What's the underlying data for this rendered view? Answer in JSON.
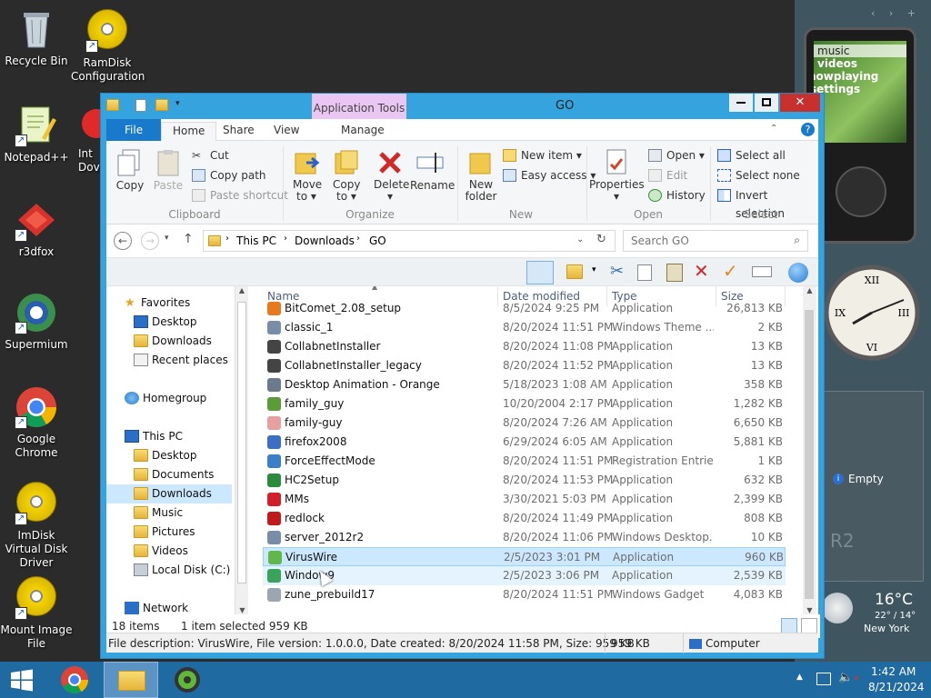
{
  "desktop": {
    "icons": [
      {
        "label": "Recycle Bin"
      },
      {
        "label": "RamDisk Configuration"
      },
      {
        "label": "Notepad++"
      },
      {
        "label": "Int Dov"
      },
      {
        "label": "r3dfox"
      },
      {
        "label": "Supermium"
      },
      {
        "label": "Google Chrome"
      },
      {
        "label": "ImDisk Virtual Disk Driver"
      },
      {
        "label": "Mount Image File"
      }
    ]
  },
  "gadgets": {
    "zune_menu": [
      "music",
      "videos",
      "nowplaying",
      "settings"
    ],
    "recycle": {
      "label": "Empty"
    },
    "weather": {
      "temp": "16°C",
      "range": "22° / 14°",
      "city": "New York"
    },
    "r2": "R2"
  },
  "window": {
    "title": "GO",
    "app_tools_label": "Application Tools",
    "tabs": [
      "File",
      "Home",
      "Share",
      "View",
      "Manage"
    ],
    "ribbon": {
      "clipboard": {
        "copy": "Copy",
        "paste": "Paste",
        "cut": "Cut",
        "copy_path": "Copy path",
        "paste_shortcut": "Paste shortcut",
        "label": "Clipboard"
      },
      "organize": {
        "move_to": "Move to ▾",
        "copy_to": "Copy to ▾",
        "delete": "Delete ▾",
        "rename": "Rename",
        "label": "Organize"
      },
      "new": {
        "new_folder": "New folder",
        "new_item": "New item ▾",
        "easy_access": "Easy access ▾",
        "label": "New"
      },
      "open": {
        "properties": "Properties ▾",
        "open": "Open ▾",
        "edit": "Edit",
        "history": "History",
        "label": "Open"
      },
      "select": {
        "select_all": "Select all",
        "select_none": "Select none",
        "invert": "Invert selection",
        "label": "Select"
      }
    },
    "address": {
      "crumbs": [
        "This PC",
        "Downloads",
        "GO"
      ],
      "search_placeholder": "Search GO"
    },
    "nav": {
      "favorites": "Favorites",
      "fav_items": [
        "Desktop",
        "Downloads",
        "Recent places"
      ],
      "homegroup": "Homegroup",
      "thispc": "This PC",
      "pc_items": [
        "Desktop",
        "Documents",
        "Downloads",
        "Music",
        "Pictures",
        "Videos",
        "Local Disk (C:)"
      ],
      "network": "Network"
    },
    "columns": [
      "Name",
      "Date modified",
      "Type",
      "Size"
    ],
    "files": [
      {
        "name": "BitComet_2.08_setup",
        "date": "8/5/2024 9:25 PM",
        "type": "Application",
        "size": "26,813 KB",
        "color": "#e87a1e"
      },
      {
        "name": "classic_1",
        "date": "8/20/2024 11:51 PM",
        "type": "Windows Theme ...",
        "size": "2 KB",
        "color": "#7a8da8"
      },
      {
        "name": "CollabnetInstaller",
        "date": "8/20/2024 11:08 PM",
        "type": "Application",
        "size": "13 KB",
        "color": "#444444"
      },
      {
        "name": "CollabnetInstaller_legacy",
        "date": "8/20/2024 11:52 PM",
        "type": "Application",
        "size": "13 KB",
        "color": "#444444"
      },
      {
        "name": "Desktop Animation - Orange",
        "date": "5/18/2023 1:08 AM",
        "type": "Application",
        "size": "358 KB",
        "color": "#6a7b8c"
      },
      {
        "name": "family_guy",
        "date": "10/20/2004 2:17 PM",
        "type": "Application",
        "size": "1,282 KB",
        "color": "#5b9c3a"
      },
      {
        "name": "family-guy",
        "date": "8/20/2024 7:26 AM",
        "type": "Application",
        "size": "6,650 KB",
        "color": "#e6a0a0"
      },
      {
        "name": "firefox2008",
        "date": "6/29/2024 6:05 AM",
        "type": "Application",
        "size": "5,881 KB",
        "color": "#3a6fc4"
      },
      {
        "name": "ForceEffectMode",
        "date": "8/20/2024 11:51 PM",
        "type": "Registration Entries",
        "size": "1 KB",
        "color": "#3b7fc9"
      },
      {
        "name": "HC2Setup",
        "date": "8/20/2024 11:53 PM",
        "type": "Application",
        "size": "632 KB",
        "color": "#2c8a3c"
      },
      {
        "name": "MMs",
        "date": "3/30/2021 5:03 PM",
        "type": "Application",
        "size": "2,399 KB",
        "color": "#d0202a"
      },
      {
        "name": "redlock",
        "date": "8/20/2024 11:49 PM",
        "type": "Application",
        "size": "808 KB",
        "color": "#c01a1a"
      },
      {
        "name": "server_2012r2",
        "date": "8/20/2024 11:06 PM",
        "type": "Windows Desktop...",
        "size": "10 KB",
        "color": "#7a8da8"
      },
      {
        "name": "VirusWire",
        "date": "2/5/2023 3:01 PM",
        "type": "Application",
        "size": "960 KB",
        "color": "#5fb848"
      },
      {
        "name": "Window9",
        "date": "2/5/2023 3:06 PM",
        "type": "Application",
        "size": "2,539 KB",
        "color": "#3aa35a"
      },
      {
        "name": "zune_prebuild17",
        "date": "8/20/2024 11:51 PM",
        "type": "Windows Gadget",
        "size": "4,083 KB",
        "color": "#9aa6b0"
      }
    ],
    "status": {
      "items": "18 items",
      "selected": "1 item selected  959 KB"
    },
    "details": {
      "description": "File description: VirusWire, File version: 1.0.0.0, Date created: 8/20/2024 11:58 PM, Size: 959 KB",
      "size": "959 KB",
      "location": "Computer"
    }
  },
  "taskbar": {
    "time": "1:42 AM",
    "date": "8/21/2024"
  }
}
